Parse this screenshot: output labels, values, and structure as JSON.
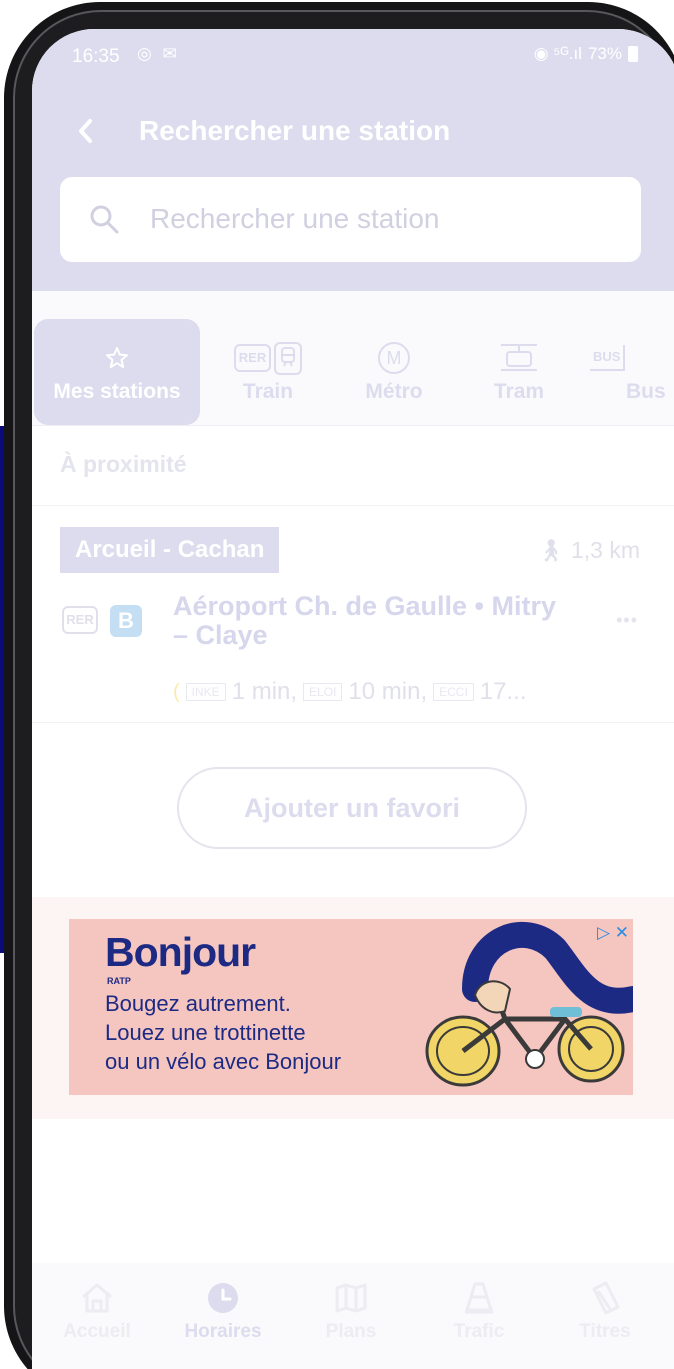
{
  "status_bar": {
    "time": "16:35",
    "left_icons": "◎ ✉",
    "right_icons": "◉ ⁵ᴳ.ıl",
    "battery": "73%"
  },
  "header": {
    "title": "Rechercher une station",
    "search_placeholder": "Rechercher une station"
  },
  "tabs": [
    {
      "label": "Mes stations",
      "icon": "star-icon",
      "active": true
    },
    {
      "label": "Train",
      "icon": "rer-train-icon",
      "badges": [
        "RER"
      ]
    },
    {
      "label": "Métro",
      "icon": "metro-icon",
      "badges": [
        "M"
      ]
    },
    {
      "label": "Tram",
      "icon": "tram-icon"
    },
    {
      "label": "Bus",
      "icon": "bus-icon",
      "badges": [
        "BUS"
      ]
    }
  ],
  "nearby": {
    "heading": "À proximité",
    "station_name": "Arcueil - Cachan",
    "distance": "1,3 km",
    "mode_badge": "RER",
    "line": "B",
    "destination": "Aéroport Ch. de Gaulle • Mitry – Claye",
    "departures": [
      {
        "code": "INKE",
        "time": "1 min,"
      },
      {
        "code": "ELOI",
        "time": "10 min,"
      },
      {
        "code": "ECCI",
        "time": "17..."
      }
    ]
  },
  "add_favorite": "Ajouter un favori",
  "ad": {
    "brand": "Bonjour",
    "brand_sub": "RATP",
    "lines": [
      "Bougez autrement.",
      "Louez une trottinette",
      "ou un vélo avec Bonjour"
    ],
    "adchoices": "▷ ✕"
  },
  "bottom_nav": [
    {
      "label": "Accueil",
      "icon": "home-icon"
    },
    {
      "label": "Horaires",
      "icon": "clock-icon",
      "active": true
    },
    {
      "label": "Plans",
      "icon": "map-icon"
    },
    {
      "label": "Trafic",
      "icon": "traffic-cone-icon"
    },
    {
      "label": "Titres",
      "icon": "ticket-icon"
    }
  ],
  "colors": {
    "header_bg": "#dcdcee",
    "accent_navy": "#0b0a7a",
    "ad_bg": "#f5c6c0",
    "ad_text": "#1d2a84"
  }
}
